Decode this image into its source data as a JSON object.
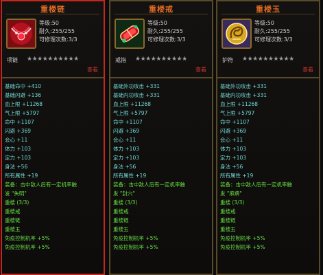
{
  "items": [
    {
      "title": "重楼链",
      "icon": "red-necklace-icon",
      "level": "等级:50",
      "durability": "耐久:255/255",
      "repairs": "可修理次数:3/3",
      "type": "项链",
      "stars": "★★★★★★★★★★",
      "note": "查看",
      "attrs": [
        {
          "text": "基础命中 +410",
          "color": "#6fd8d6"
        },
        {
          "text": "基础闪避 +136",
          "color": "#6fd8d6"
        },
        {
          "text": "血上限 +11268",
          "color": "#6fd8d6"
        },
        {
          "text": "气上限 +5797",
          "color": "#6fd8d6"
        },
        {
          "text": "命中 +1107",
          "color": "#6fd8d6"
        },
        {
          "text": "闪避 +369",
          "color": "#6fd8d6"
        },
        {
          "text": "会心 +11",
          "color": "#6fd8d6"
        },
        {
          "text": "体力 +103",
          "color": "#6fd8d6"
        },
        {
          "text": "定力 +103",
          "color": "#6fd8d6"
        },
        {
          "text": "身法 +56",
          "color": "#6fd8d6"
        },
        {
          "text": "所有属性 +19",
          "color": "#6fd8d6"
        },
        {
          "text": "装备：击中敌人后有一定机率触",
          "color": "#66dd44"
        },
        {
          "text": "发 \"失明\"",
          "color": "#66dd44"
        },
        {
          "text": "重楼  (3/3)",
          "color": "#66dd44"
        },
        {
          "text": "重楼戒",
          "color": "#66dd44"
        },
        {
          "text": "重楼链",
          "color": "#66dd44"
        },
        {
          "text": "重楼玉",
          "color": "#66dd44"
        },
        {
          "text": "免疫控制机率 +5%",
          "color": "#66dd44"
        },
        {
          "text": "免疫控制机率 +5%",
          "color": "#66dd44"
        }
      ]
    },
    {
      "title": "重楼戒",
      "icon": "red-ring-icon",
      "level": "等级:50",
      "durability": "耐久:255/255",
      "repairs": "可修理次数:3/3",
      "type": "戒指",
      "stars": "★★★★★★★★★★",
      "note": "查看",
      "attrs": [
        {
          "text": "基础外功攻击 +331",
          "color": "#6fd8d6"
        },
        {
          "text": "基础内功攻击 +331",
          "color": "#6fd8d6"
        },
        {
          "text": "血上限 +11268",
          "color": "#6fd8d6"
        },
        {
          "text": "气上限 +5797",
          "color": "#6fd8d6"
        },
        {
          "text": "命中 +1107",
          "color": "#6fd8d6"
        },
        {
          "text": "闪避 +369",
          "color": "#6fd8d6"
        },
        {
          "text": "会心 +11",
          "color": "#6fd8d6"
        },
        {
          "text": "体力 +103",
          "color": "#6fd8d6"
        },
        {
          "text": "定力 +103",
          "color": "#6fd8d6"
        },
        {
          "text": "身法 +56",
          "color": "#6fd8d6"
        },
        {
          "text": "所有属性 +19",
          "color": "#6fd8d6"
        },
        {
          "text": "装备：击中敌人后有一定机率触",
          "color": "#66dd44"
        },
        {
          "text": "发 \"封穴\"",
          "color": "#66dd44"
        },
        {
          "text": "重楼  (3/3)",
          "color": "#66dd44"
        },
        {
          "text": "重楼戒",
          "color": "#66dd44"
        },
        {
          "text": "重楼链",
          "color": "#66dd44"
        },
        {
          "text": "重楼玉",
          "color": "#66dd44"
        },
        {
          "text": "免疫控制机率 +5%",
          "color": "#66dd44"
        },
        {
          "text": "免疫控制机率 +5%",
          "color": "#66dd44"
        }
      ]
    },
    {
      "title": "重楼玉",
      "icon": "golden-dragon-jade-icon",
      "level": "等级:50",
      "durability": "耐久:255/255",
      "repairs": "可修理次数:3/3",
      "type": "护符",
      "stars": "★★★★★★★★★★",
      "note": "查看",
      "attrs": [
        {
          "text": "基础外功攻击 +331",
          "color": "#6fd8d6"
        },
        {
          "text": "基础内功攻击 +331",
          "color": "#6fd8d6"
        },
        {
          "text": "血上限 +11268",
          "color": "#6fd8d6"
        },
        {
          "text": "气上限 +5797",
          "color": "#6fd8d6"
        },
        {
          "text": "命中 +1107",
          "color": "#6fd8d6"
        },
        {
          "text": "闪避 +369",
          "color": "#6fd8d6"
        },
        {
          "text": "会心 +11",
          "color": "#6fd8d6"
        },
        {
          "text": "体力 +103",
          "color": "#6fd8d6"
        },
        {
          "text": "定力 +103",
          "color": "#6fd8d6"
        },
        {
          "text": "身法 +56",
          "color": "#6fd8d6"
        },
        {
          "text": "所有属性 +19",
          "color": "#6fd8d6"
        },
        {
          "text": "装备：击中敌人后有一定机率触",
          "color": "#66dd44"
        },
        {
          "text": "发 \"麻痹\"",
          "color": "#66dd44"
        },
        {
          "text": "重楼  (3/3)",
          "color": "#66dd44"
        },
        {
          "text": "重楼戒",
          "color": "#66dd44"
        },
        {
          "text": "重楼链",
          "color": "#66dd44"
        },
        {
          "text": "重楼玉",
          "color": "#66dd44"
        },
        {
          "text": "免疫控制机率 +5%",
          "color": "#66dd44"
        },
        {
          "text": "免疫控制机率 +5%",
          "color": "#66dd44"
        }
      ]
    }
  ],
  "colors": {
    "selected_border": "#c8251d",
    "title": "#e06a22",
    "base_attr": "#6fd8d6",
    "set_attr": "#66dd44",
    "note": "#d0362a"
  }
}
